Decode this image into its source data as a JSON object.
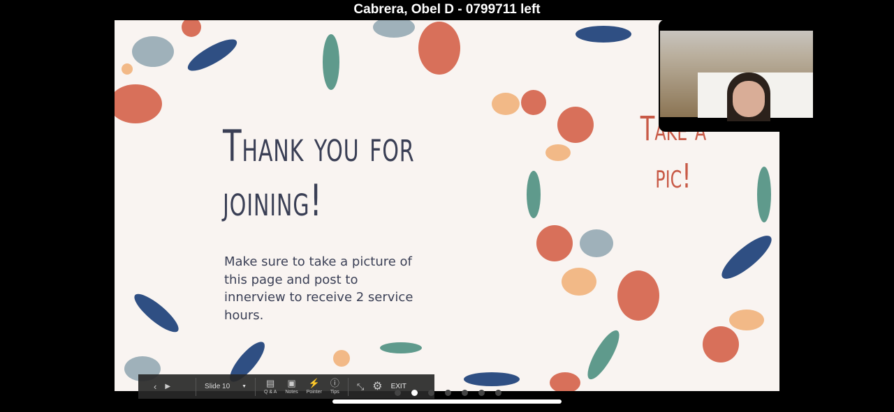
{
  "window_title": "Cabrera, Obel D - 0799711 left",
  "slide": {
    "title": "Thank you for joining!",
    "body": "Make sure to take a picture of this page and post to innerview to receive 2 service hours.",
    "side_text": "Take a pic!"
  },
  "toolbar": {
    "prev": "‹",
    "play": "▶",
    "slide_select": "Slide 10",
    "qa": "Q & A",
    "notes": "Notes",
    "pointer": "Pointer",
    "tips": "Tips",
    "exit": "EXIT"
  },
  "colors": {
    "title": "#3a3f55",
    "accent": "#c85a47",
    "slide_bg": "#f9f4f1"
  }
}
